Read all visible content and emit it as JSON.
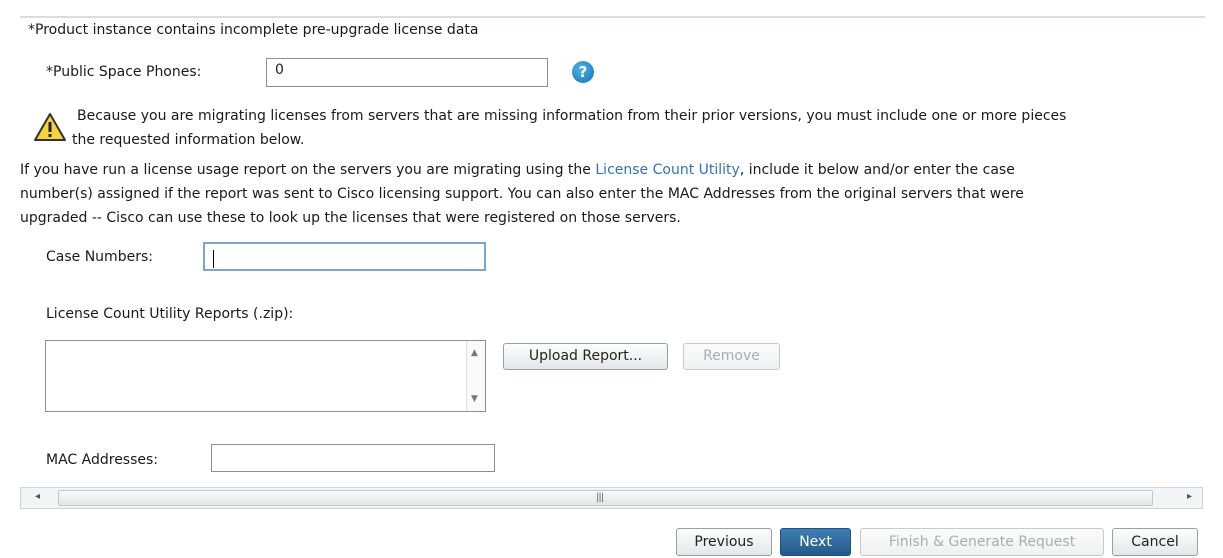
{
  "notice": "*Product instance contains incomplete pre-upgrade license data",
  "phones": {
    "label": "*Public Space Phones:",
    "value": "0",
    "help_icon": "?"
  },
  "warning": {
    "icon": "warning-triangle-icon",
    "line1": "Because you are migrating licenses from servers that are missing information from their prior versions, you must include one or more pieces",
    "line2": "the requested information below."
  },
  "instructions": {
    "line1_pre": "If you have run a license usage report on the servers you are migrating using the ",
    "link": "License Count Utility",
    "line1_post": ", include it below and/or enter the case",
    "line2": "number(s) assigned if the report was sent to Cisco licensing support. You can also enter the MAC Addresses from the original servers that were",
    "line3": "upgraded -- Cisco can use these to look up the licenses that were registered on those servers."
  },
  "case_numbers": {
    "label": "Case Numbers:",
    "value": ""
  },
  "reports": {
    "label": "License Count Utility Reports (.zip):",
    "upload_label": "Upload Report...",
    "remove_label": "Remove",
    "scroll_up": "▲",
    "scroll_down": "▼"
  },
  "mac": {
    "label": "MAC Addresses:",
    "value": ""
  },
  "hscroll": {
    "left": "◂",
    "right": "▸",
    "grip": "|||"
  },
  "buttons": {
    "previous": "Previous",
    "next": "Next",
    "finish": "Finish & Generate Request",
    "cancel": "Cancel"
  },
  "colors": {
    "link": "#2f74b8",
    "primary": "#2d6799",
    "help": "#1e88cc"
  }
}
